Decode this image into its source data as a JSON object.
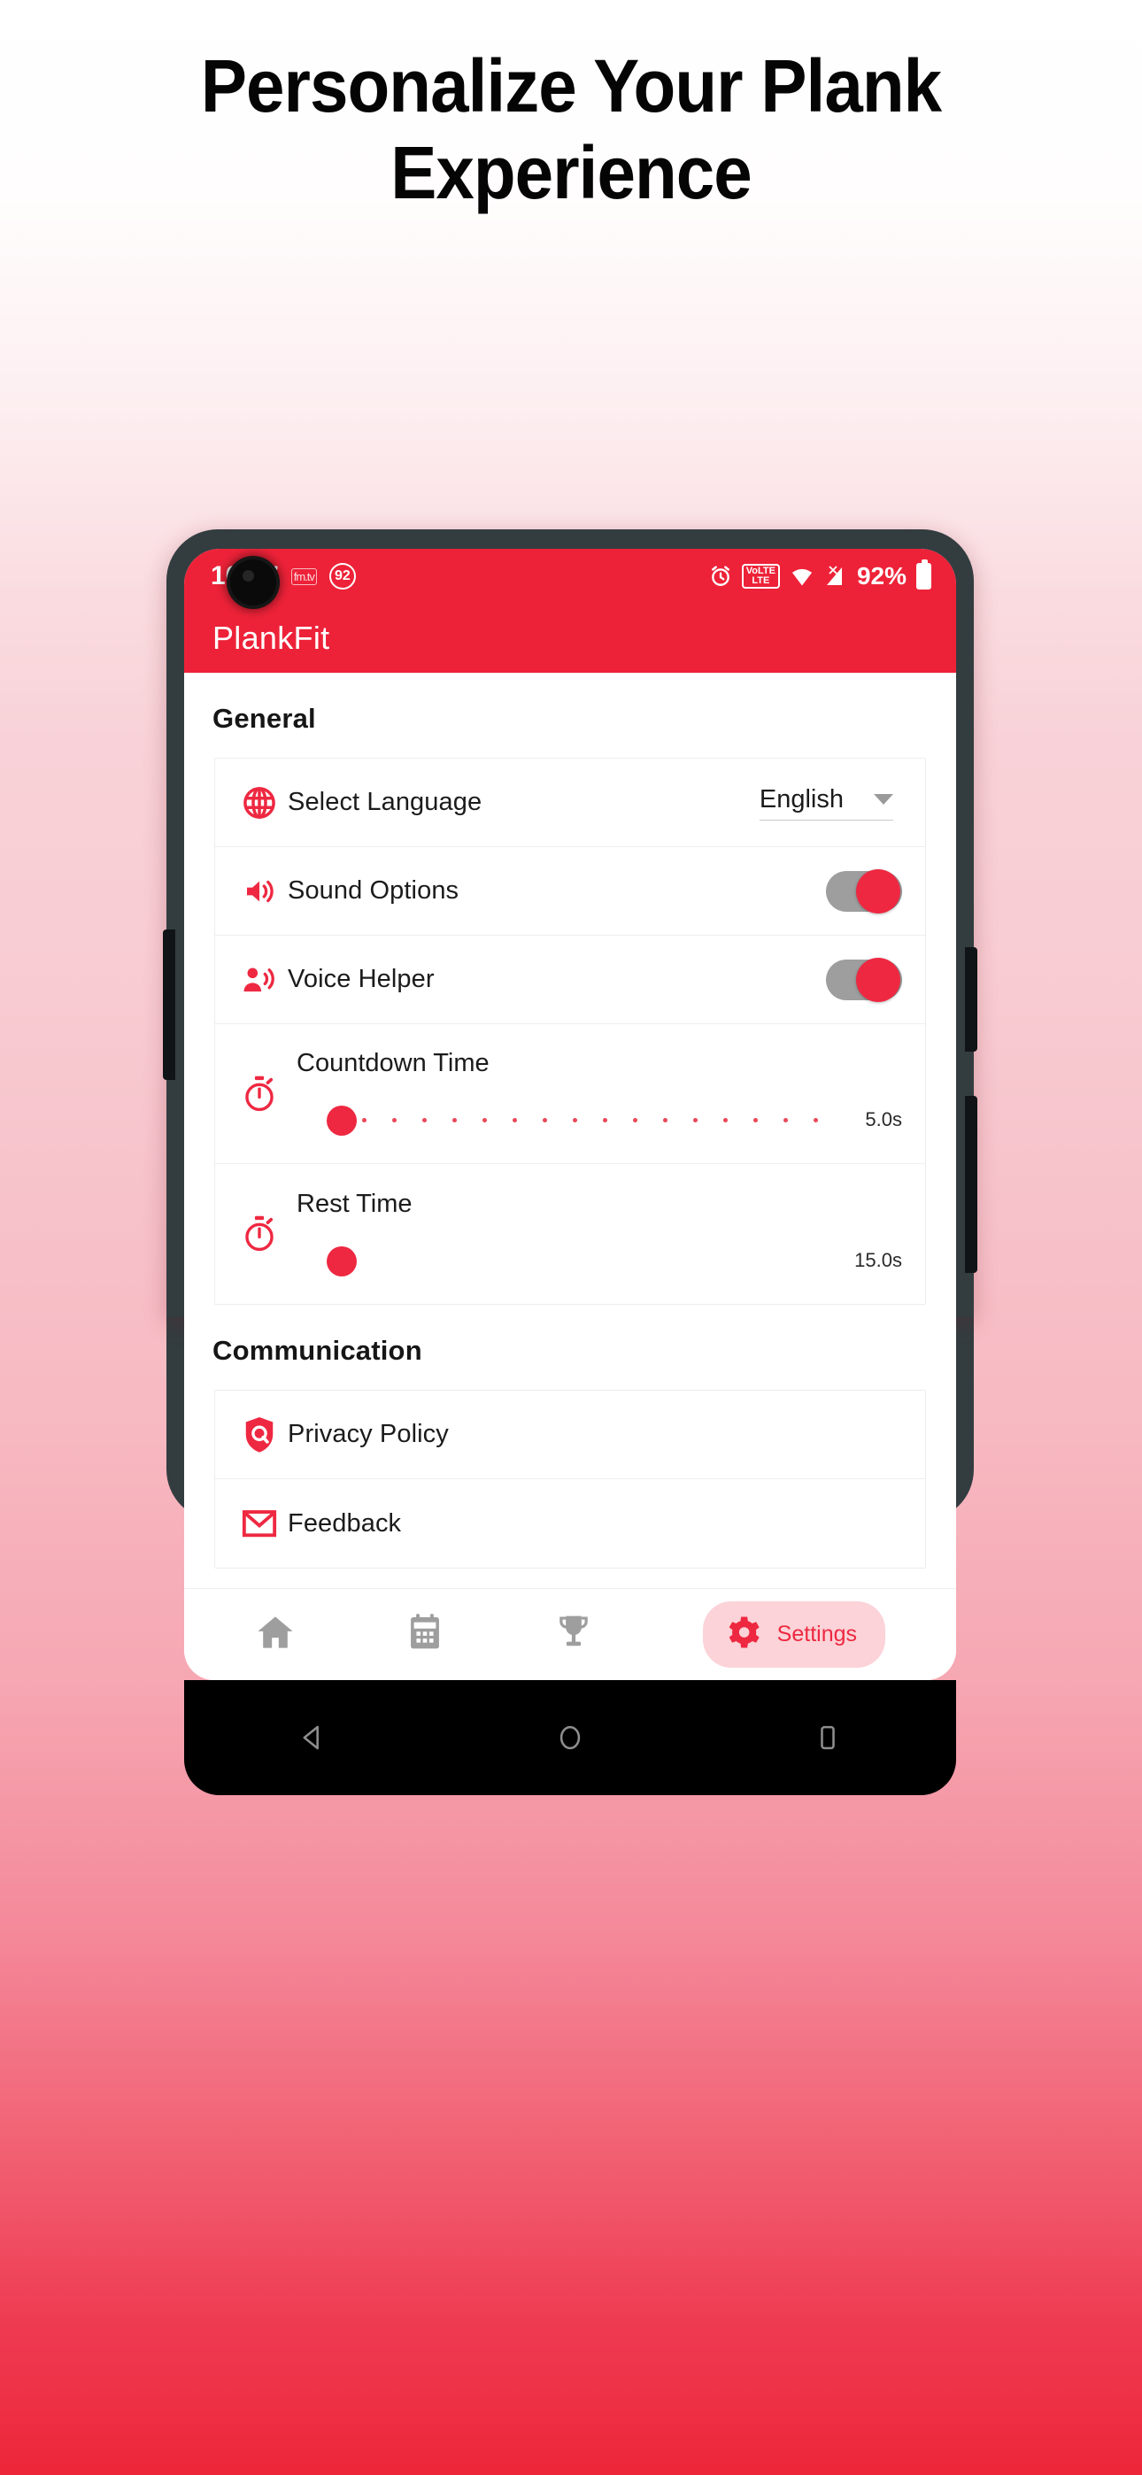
{
  "headline": {
    "line1": "Personalize Your Plank",
    "line2": "Experience"
  },
  "colors": {
    "brand_red": "#ED2238",
    "accent_red": "#EE2841",
    "pill_bg": "#FBD3D8",
    "toggle_track": "#9E9E9E",
    "frame": "#333D40"
  },
  "status_bar": {
    "time": "10:07",
    "mini_badge": "fm.tv",
    "circle_badge": "92",
    "alarm_icon": "alarm-clock-icon",
    "lte_top": "VoLTE",
    "lte_bottom": "LTE",
    "wifi_icon": "wifi-icon",
    "signal_icon": "signal-bars-icon",
    "battery_percent": "92%",
    "battery_icon": "battery-icon"
  },
  "app_bar": {
    "title": "PlankFit"
  },
  "sections": [
    {
      "title": "General",
      "rows": [
        {
          "type": "dropdown",
          "icon": "globe-icon",
          "label": "Select Language",
          "value": "English",
          "arrow_icon": "chevron-down-icon"
        },
        {
          "type": "toggle",
          "icon": "volume-up-icon",
          "label": "Sound Options",
          "state": "on"
        },
        {
          "type": "toggle",
          "icon": "voice-person-icon",
          "label": "Voice Helper",
          "state": "on"
        },
        {
          "type": "slider",
          "icon": "stopwatch-icon",
          "label": "Countdown Time",
          "value": "5.0s",
          "thumb_percent": 6,
          "ticks": 16
        },
        {
          "type": "slider",
          "icon": "stopwatch-icon",
          "label": "Rest Time",
          "value": "15.0s",
          "thumb_percent": 6,
          "ticks": 0
        }
      ]
    },
    {
      "title": "Communication",
      "rows": [
        {
          "type": "link",
          "icon": "shield-privacy-icon",
          "label": "Privacy Policy"
        },
        {
          "type": "link",
          "icon": "envelope-icon",
          "label": "Feedback"
        }
      ]
    }
  ],
  "bottom_nav": {
    "items": [
      {
        "icon": "home-icon",
        "label": "",
        "active": false
      },
      {
        "icon": "calendar-icon",
        "label": "",
        "active": false
      },
      {
        "icon": "trophy-icon",
        "label": "",
        "active": false
      },
      {
        "icon": "gear-icon",
        "label": "Settings",
        "active": true
      }
    ]
  },
  "android_nav": {
    "back": "back-triangle-icon",
    "home": "home-circle-icon",
    "recents": "recents-square-icon"
  }
}
